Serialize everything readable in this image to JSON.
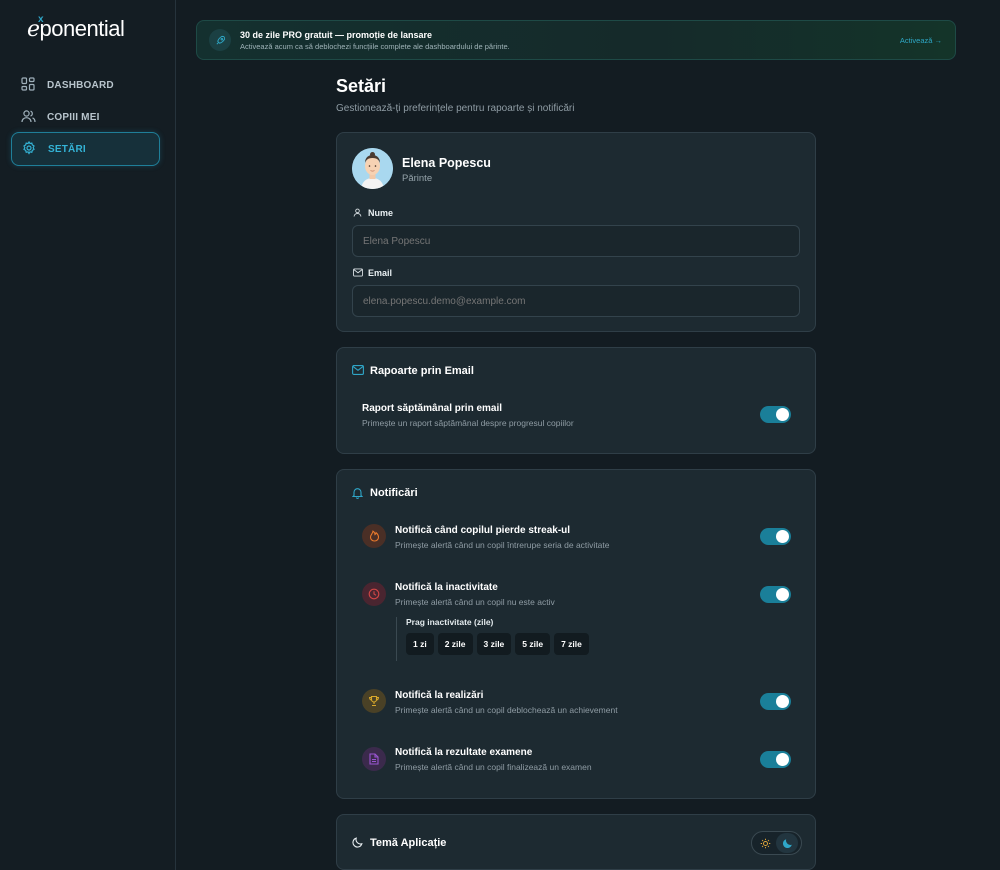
{
  "app": {
    "logo_e": "e",
    "logo_sup": "x",
    "logo_rest": "ponential"
  },
  "sidebar": {
    "items": [
      {
        "label": "DASHBOARD",
        "icon": "grid-icon",
        "active": false
      },
      {
        "label": "COPIII MEI",
        "icon": "users-icon",
        "active": false
      },
      {
        "label": "SETĂRI",
        "icon": "gear-icon",
        "active": true
      }
    ]
  },
  "promo": {
    "title": "30 de zile PRO gratuit — promoție de lansare",
    "subtitle": "Activează acum ca să deblochezi funcțiile complete ale dashboardului de părinte.",
    "cta": "Activează →"
  },
  "page": {
    "title": "Setări",
    "subtitle": "Gestionează-ți preferințele pentru rapoarte și notificări"
  },
  "profile": {
    "name": "Elena Popescu",
    "role": "Părinte",
    "name_label": "Nume",
    "name_placeholder": "Elena Popescu",
    "email_label": "Email",
    "email_placeholder": "elena.popescu.demo@example.com"
  },
  "email_reports": {
    "title": "Rapoarte prin Email",
    "weekly_title": "Raport săptămânal prin email",
    "weekly_desc": "Primește un raport săptămânal despre progresul copiilor",
    "weekly_enabled": true
  },
  "notifications": {
    "title": "Notificări",
    "items": [
      {
        "title": "Notifică când copilul pierde streak-ul",
        "desc": "Primește alertă când un copil întrerupe seria de activitate",
        "icon": "flame-icon",
        "color": "#e8792c",
        "enabled": true
      },
      {
        "title": "Notifică la inactivitate",
        "desc": "Primește alertă când un copil nu este activ",
        "icon": "clock-icon",
        "color": "#d24646",
        "enabled": true
      },
      {
        "title": "Notifică la realizări",
        "desc": "Primește alertă când un copil deblochează un achievement",
        "icon": "trophy-icon",
        "color": "#d9a92b",
        "enabled": true
      },
      {
        "title": "Notifică la rezultate examene",
        "desc": "Primește alertă când un copil finalizează un examen",
        "icon": "document-icon",
        "color": "#9a55d1",
        "enabled": true
      }
    ],
    "threshold_label": "Prag inactivitate (zile)",
    "threshold_options": [
      "1 zi",
      "2 zile",
      "3 zile",
      "5 zile",
      "7 zile"
    ]
  },
  "theme": {
    "title": "Temă Aplicație",
    "mode": "dark"
  }
}
